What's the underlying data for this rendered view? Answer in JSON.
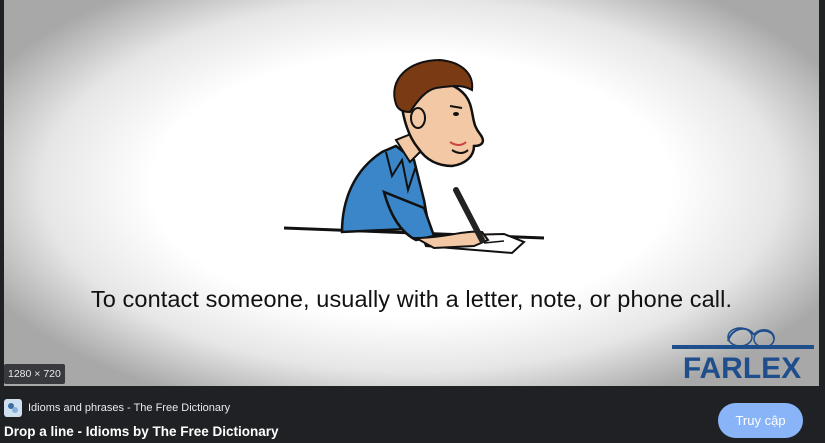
{
  "preview": {
    "caption": "To contact someone, usually with a letter, note, or phone call.",
    "dimensions": "1280 × 720",
    "logo_text": "FARLEX",
    "logo_color": "#1e4e8c"
  },
  "source": {
    "name": "Idioms and phrases - The Free Dictionary",
    "favicon": "dictionary-icon"
  },
  "result": {
    "title": "Drop a line - Idioms by The Free Dictionary",
    "visit_label": "Truy cập"
  },
  "colors": {
    "background": "#202124",
    "button": "#8ab4f8",
    "shirt": "#3a86c8",
    "hair": "#7a3a14"
  }
}
